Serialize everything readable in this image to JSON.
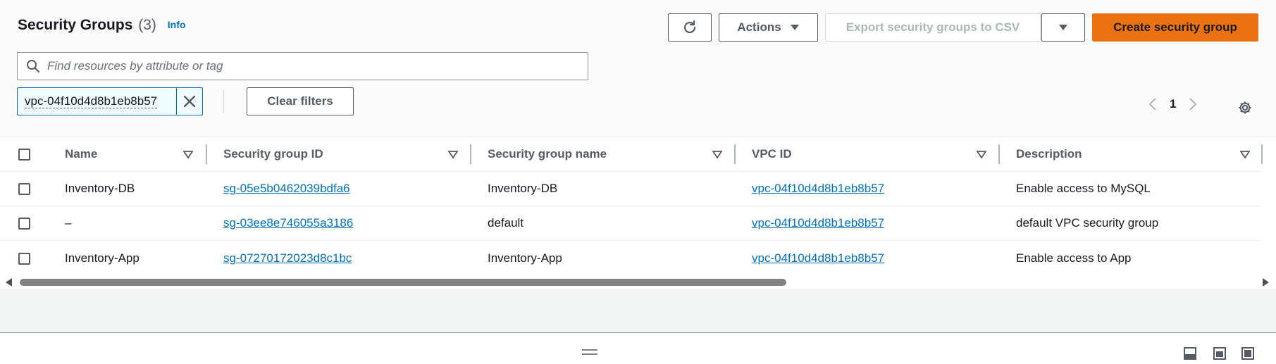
{
  "header": {
    "title": "Security Groups",
    "count": "(3)",
    "info_link": "Info"
  },
  "toolbar": {
    "actions_label": "Actions",
    "export_label": "Export security groups to CSV",
    "create_label": "Create security group"
  },
  "search": {
    "placeholder": "Find resources by attribute or tag"
  },
  "filters": {
    "token_label": "vpc-04f10d4d8b1eb8b57",
    "clear_label": "Clear filters"
  },
  "pagination": {
    "current_page": "1"
  },
  "table": {
    "columns": [
      "Name",
      "Security group ID",
      "Security group name",
      "VPC ID",
      "Description"
    ],
    "rows": [
      {
        "name": "Inventory-DB",
        "sg_id": "sg-05e5b0462039bdfa6",
        "sg_name": "Inventory-DB",
        "vpc_id": "vpc-04f10d4d8b1eb8b57",
        "description": "Enable access to MySQL"
      },
      {
        "name": "–",
        "sg_id": "sg-03ee8e746055a3186",
        "sg_name": "default",
        "vpc_id": "vpc-04f10d4d8b1eb8b57",
        "description": "default VPC security group"
      },
      {
        "name": "Inventory-App",
        "sg_id": "sg-07270172023d8c1bc",
        "sg_name": "Inventory-App",
        "vpc_id": "vpc-04f10d4d8b1eb8b57",
        "description": "Enable access to App"
      }
    ]
  },
  "colors": {
    "accent": "#ec7211",
    "link": "#0073bb"
  }
}
